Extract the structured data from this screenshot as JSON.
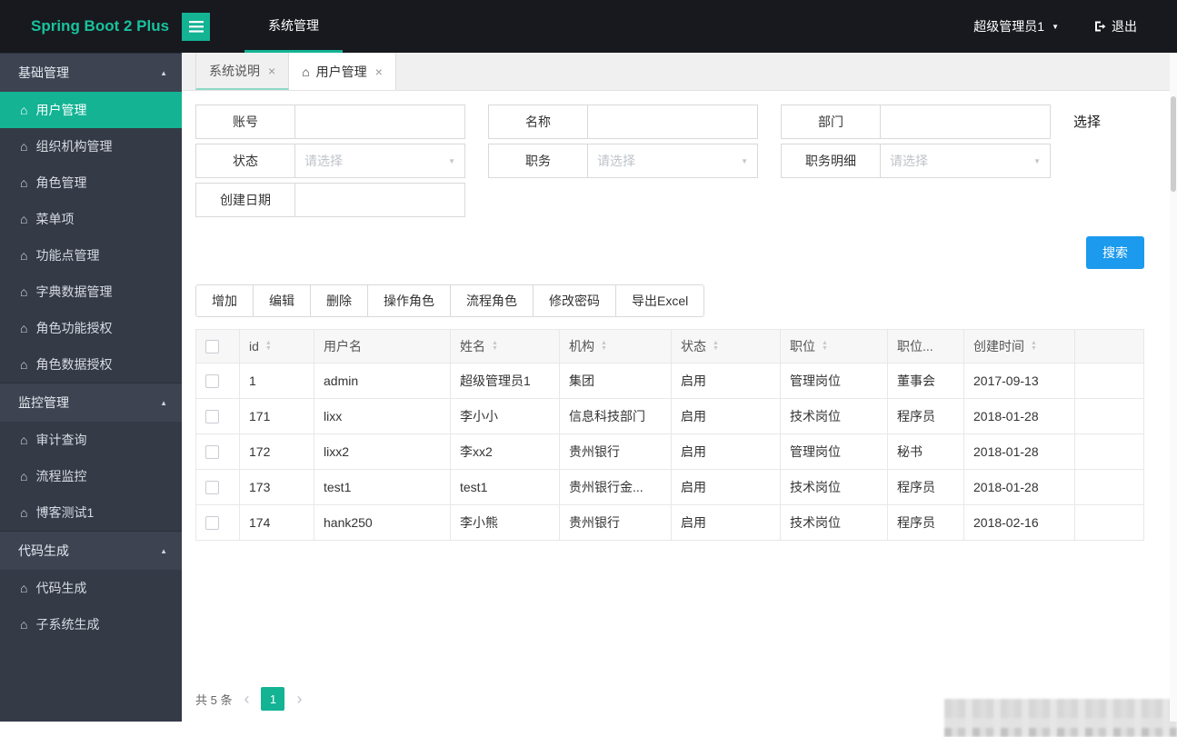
{
  "colors": {
    "accent_green": "#13b394",
    "logo_green": "#18c29c",
    "primary_blue": "#1b9aee",
    "topbar_bg": "#17191f",
    "sidebar_bg": "#343a46"
  },
  "topbar": {
    "logo": "Spring Boot 2 Plus",
    "nav": "系统管理",
    "user": "超级管理员1",
    "logout": "退出"
  },
  "tabs": [
    {
      "label": "系统说明"
    },
    {
      "label": "用户管理"
    }
  ],
  "sidebar": {
    "items": [
      {
        "type": "group",
        "label": "基础管理"
      },
      {
        "type": "item",
        "label": "用户管理",
        "active": true
      },
      {
        "type": "item",
        "label": "组织机构管理"
      },
      {
        "type": "item",
        "label": "角色管理"
      },
      {
        "type": "item",
        "label": "菜单项"
      },
      {
        "type": "item",
        "label": "功能点管理"
      },
      {
        "type": "item",
        "label": "字典数据管理"
      },
      {
        "type": "item",
        "label": "角色功能授权"
      },
      {
        "type": "item",
        "label": "角色数据授权"
      },
      {
        "type": "group",
        "label": "监控管理"
      },
      {
        "type": "item",
        "label": "审计查询"
      },
      {
        "type": "item",
        "label": "流程监控"
      },
      {
        "type": "item",
        "label": "博客测试1"
      },
      {
        "type": "group",
        "label": "代码生成"
      },
      {
        "type": "item",
        "label": "代码生成"
      },
      {
        "type": "item",
        "label": "子系统生成"
      }
    ]
  },
  "form": {
    "fields": [
      {
        "label": "账号",
        "type": "input"
      },
      {
        "label": "名称",
        "type": "input"
      },
      {
        "label": "部门",
        "type": "input"
      },
      {
        "label": "状态",
        "type": "select",
        "placeholder": "请选择"
      },
      {
        "label": "职务",
        "type": "select",
        "placeholder": "请选择"
      },
      {
        "label": "职务明细",
        "type": "select",
        "placeholder": "请选择"
      },
      {
        "label": "创建日期",
        "type": "input"
      }
    ],
    "choose_link": "选择",
    "search_button": "搜索"
  },
  "toolbar": {
    "buttons": [
      "增加",
      "编辑",
      "删除",
      "操作角色",
      "流程角色",
      "修改密码",
      "导出Excel"
    ]
  },
  "table": {
    "columns": [
      {
        "label": "id",
        "sortable": true
      },
      {
        "label": "用户名",
        "sortable": false
      },
      {
        "label": "姓名",
        "sortable": true
      },
      {
        "label": "机构",
        "sortable": true
      },
      {
        "label": "状态",
        "sortable": true
      },
      {
        "label": "职位",
        "sortable": true
      },
      {
        "label": "职位...",
        "sortable": false
      },
      {
        "label": "创建时间",
        "sortable": true
      }
    ],
    "rows": [
      [
        "1",
        "admin",
        "超级管理员1",
        "集团",
        "启用",
        "管理岗位",
        "董事会",
        "2017-09-13"
      ],
      [
        "171",
        "lixx",
        "李小小",
        "信息科技部门",
        "启用",
        "技术岗位",
        "程序员",
        "2018-01-28"
      ],
      [
        "172",
        "lixx2",
        "李xx2",
        "贵州银行",
        "启用",
        "管理岗位",
        "秘书",
        "2018-01-28"
      ],
      [
        "173",
        "test1",
        "test1",
        "贵州银行金...",
        "启用",
        "技术岗位",
        "程序员",
        "2018-01-28"
      ],
      [
        "174",
        "hank250",
        "李小熊",
        "贵州银行",
        "启用",
        "技术岗位",
        "程序员",
        "2018-02-16"
      ]
    ]
  },
  "pagination": {
    "total": "共 5 条",
    "current_page": "1"
  }
}
